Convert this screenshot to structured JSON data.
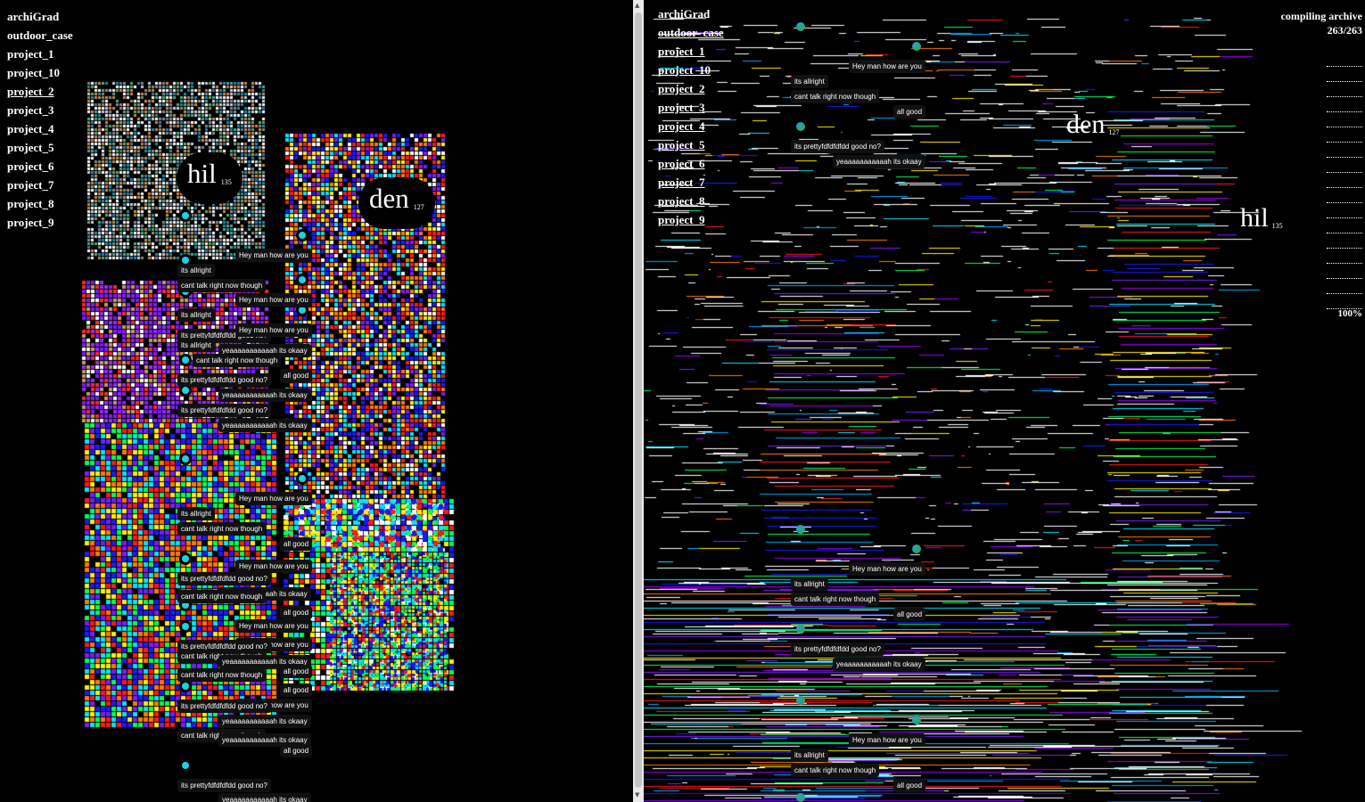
{
  "nav": {
    "items": [
      "archiGrad",
      "outdoor_case",
      "project_1",
      "project_10",
      "project_2",
      "project_3",
      "project_4",
      "project_5",
      "project_6",
      "project_7",
      "project_8",
      "project_9"
    ],
    "underlined": "project_2"
  },
  "labels": {
    "hil": {
      "name": "hil",
      "count": "135"
    },
    "den": {
      "name": "den",
      "count": "127"
    }
  },
  "chat": {
    "m1": "Hey man how are you",
    "m2": "its allright",
    "m3": "cant talk right now though",
    "m4": "all good",
    "m5": "its prettyfdfdfdfdd good no?",
    "m6": "yeaaaaaaaaaaah its okaay"
  },
  "status": {
    "title": "compiling archive",
    "count": "263/263",
    "percent": "100%"
  },
  "colors": {
    "cyan_dot": "#19d3e6",
    "background": "#000000",
    "pane_divider": "#eaeaea"
  },
  "icons": [
    "scroll-up-arrow-icon",
    "scroll-down-arrow-icon",
    "chat-dot-icon",
    "orb-dot-icon"
  ]
}
